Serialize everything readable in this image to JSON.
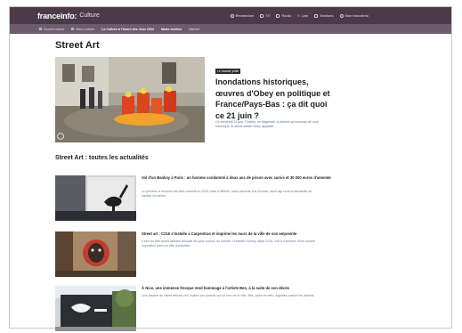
{
  "header": {
    "logo": "franceinfo:",
    "section": "Culture",
    "nav": [
      {
        "label": "Rechercher",
        "icon": "search-icon"
      },
      {
        "label": "TV",
        "icon": "tv-icon"
      },
      {
        "label": "Radio",
        "icon": "radio-icon"
      },
      {
        "label": "Live",
        "icon": "live-dot-icon"
      },
      {
        "label": "Sections",
        "icon": "menu-icon"
      },
      {
        "label": "Mon franceinfo",
        "icon": "user-icon"
      }
    ]
  },
  "subnav": {
    "items": [
      {
        "label": "Accueil culture"
      },
      {
        "label": "Menu culture"
      },
      {
        "label": "La Culture à l'heure des Jeux 2024"
      },
      {
        "label": "Mode section"
      },
      {
        "label": "Internet"
      }
    ]
  },
  "page": {
    "title": "Street Art"
  },
  "hero": {
    "badge": "Le dossier juillet",
    "title": "Inondations historiques, œuvres d'Obey en politique et France/Pays-Bas : ça dit quoi ce 21 juin ?",
    "description": "Ce vendredi 21 juin, l'Outbis, en Mayenne, a célébré sa nouveau de crue historique, le street artiste Obey apparaît..."
  },
  "news": {
    "section_title": "Street Art : toutes les actualités",
    "articles": [
      {
        "title": "Vol d'un Banksy à Paris : un homme condamné à deux ans de prison avec sursis et 30 000 euros d'amende",
        "description": "Le prévenu a reconnu les faits commis en 2024 mais a affirmé, sans parvenir à le prouver, avoir agi sous la demande de l'artiste lui-même."
      },
      {
        "title": "Street art : C215 s'installe à Carpentras et imprime les murs de la ville de son empreinte",
        "description": "Il est l'un des street-artistes français les plus connus au monde. Christian Guémy, alias C215, voit à l'honneur d'une double exposition dans sa ville d'adoption."
      },
      {
        "title": "À Nice, une immense fresque rend hommage à l'artiste Ben, à la suite de son décès",
        "description": "Une dizaine de street artistes ont réalisé une portrait sur un mur de la ville. Ben, peint en bleu, signales passer les piétons."
      }
    ]
  }
}
